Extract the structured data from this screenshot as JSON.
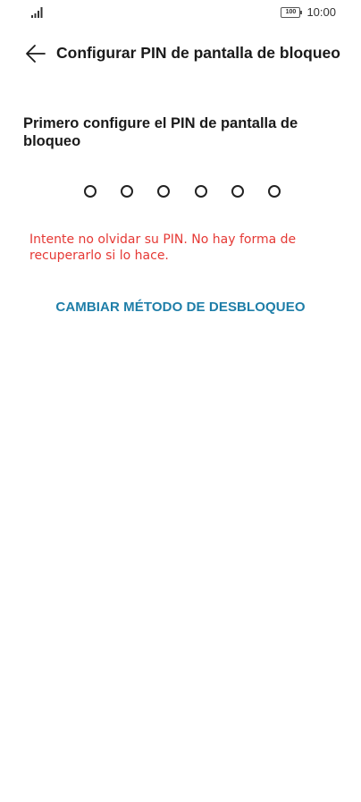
{
  "status_bar": {
    "signal_icon": "signal-bars-icon",
    "battery_level": "100",
    "time": "10:00"
  },
  "header": {
    "back_icon": "arrow-left-icon",
    "title": "Configurar PIN de pantalla de bloqueo"
  },
  "main": {
    "instruction": "Primero configure el PIN de pantalla de bloqueo",
    "pin_length": 6,
    "pin_entered": 0,
    "warning": "Intente no olvidar su PIN. No hay forma de recuperarlo si lo hace.",
    "change_method_label": "CAMBIAR MÉTODO DE DESBLOQUEO"
  },
  "colors": {
    "warning": "#e53935",
    "accent": "#1e7ea8",
    "background": "#ffffff",
    "text": "#1a1a1a"
  }
}
